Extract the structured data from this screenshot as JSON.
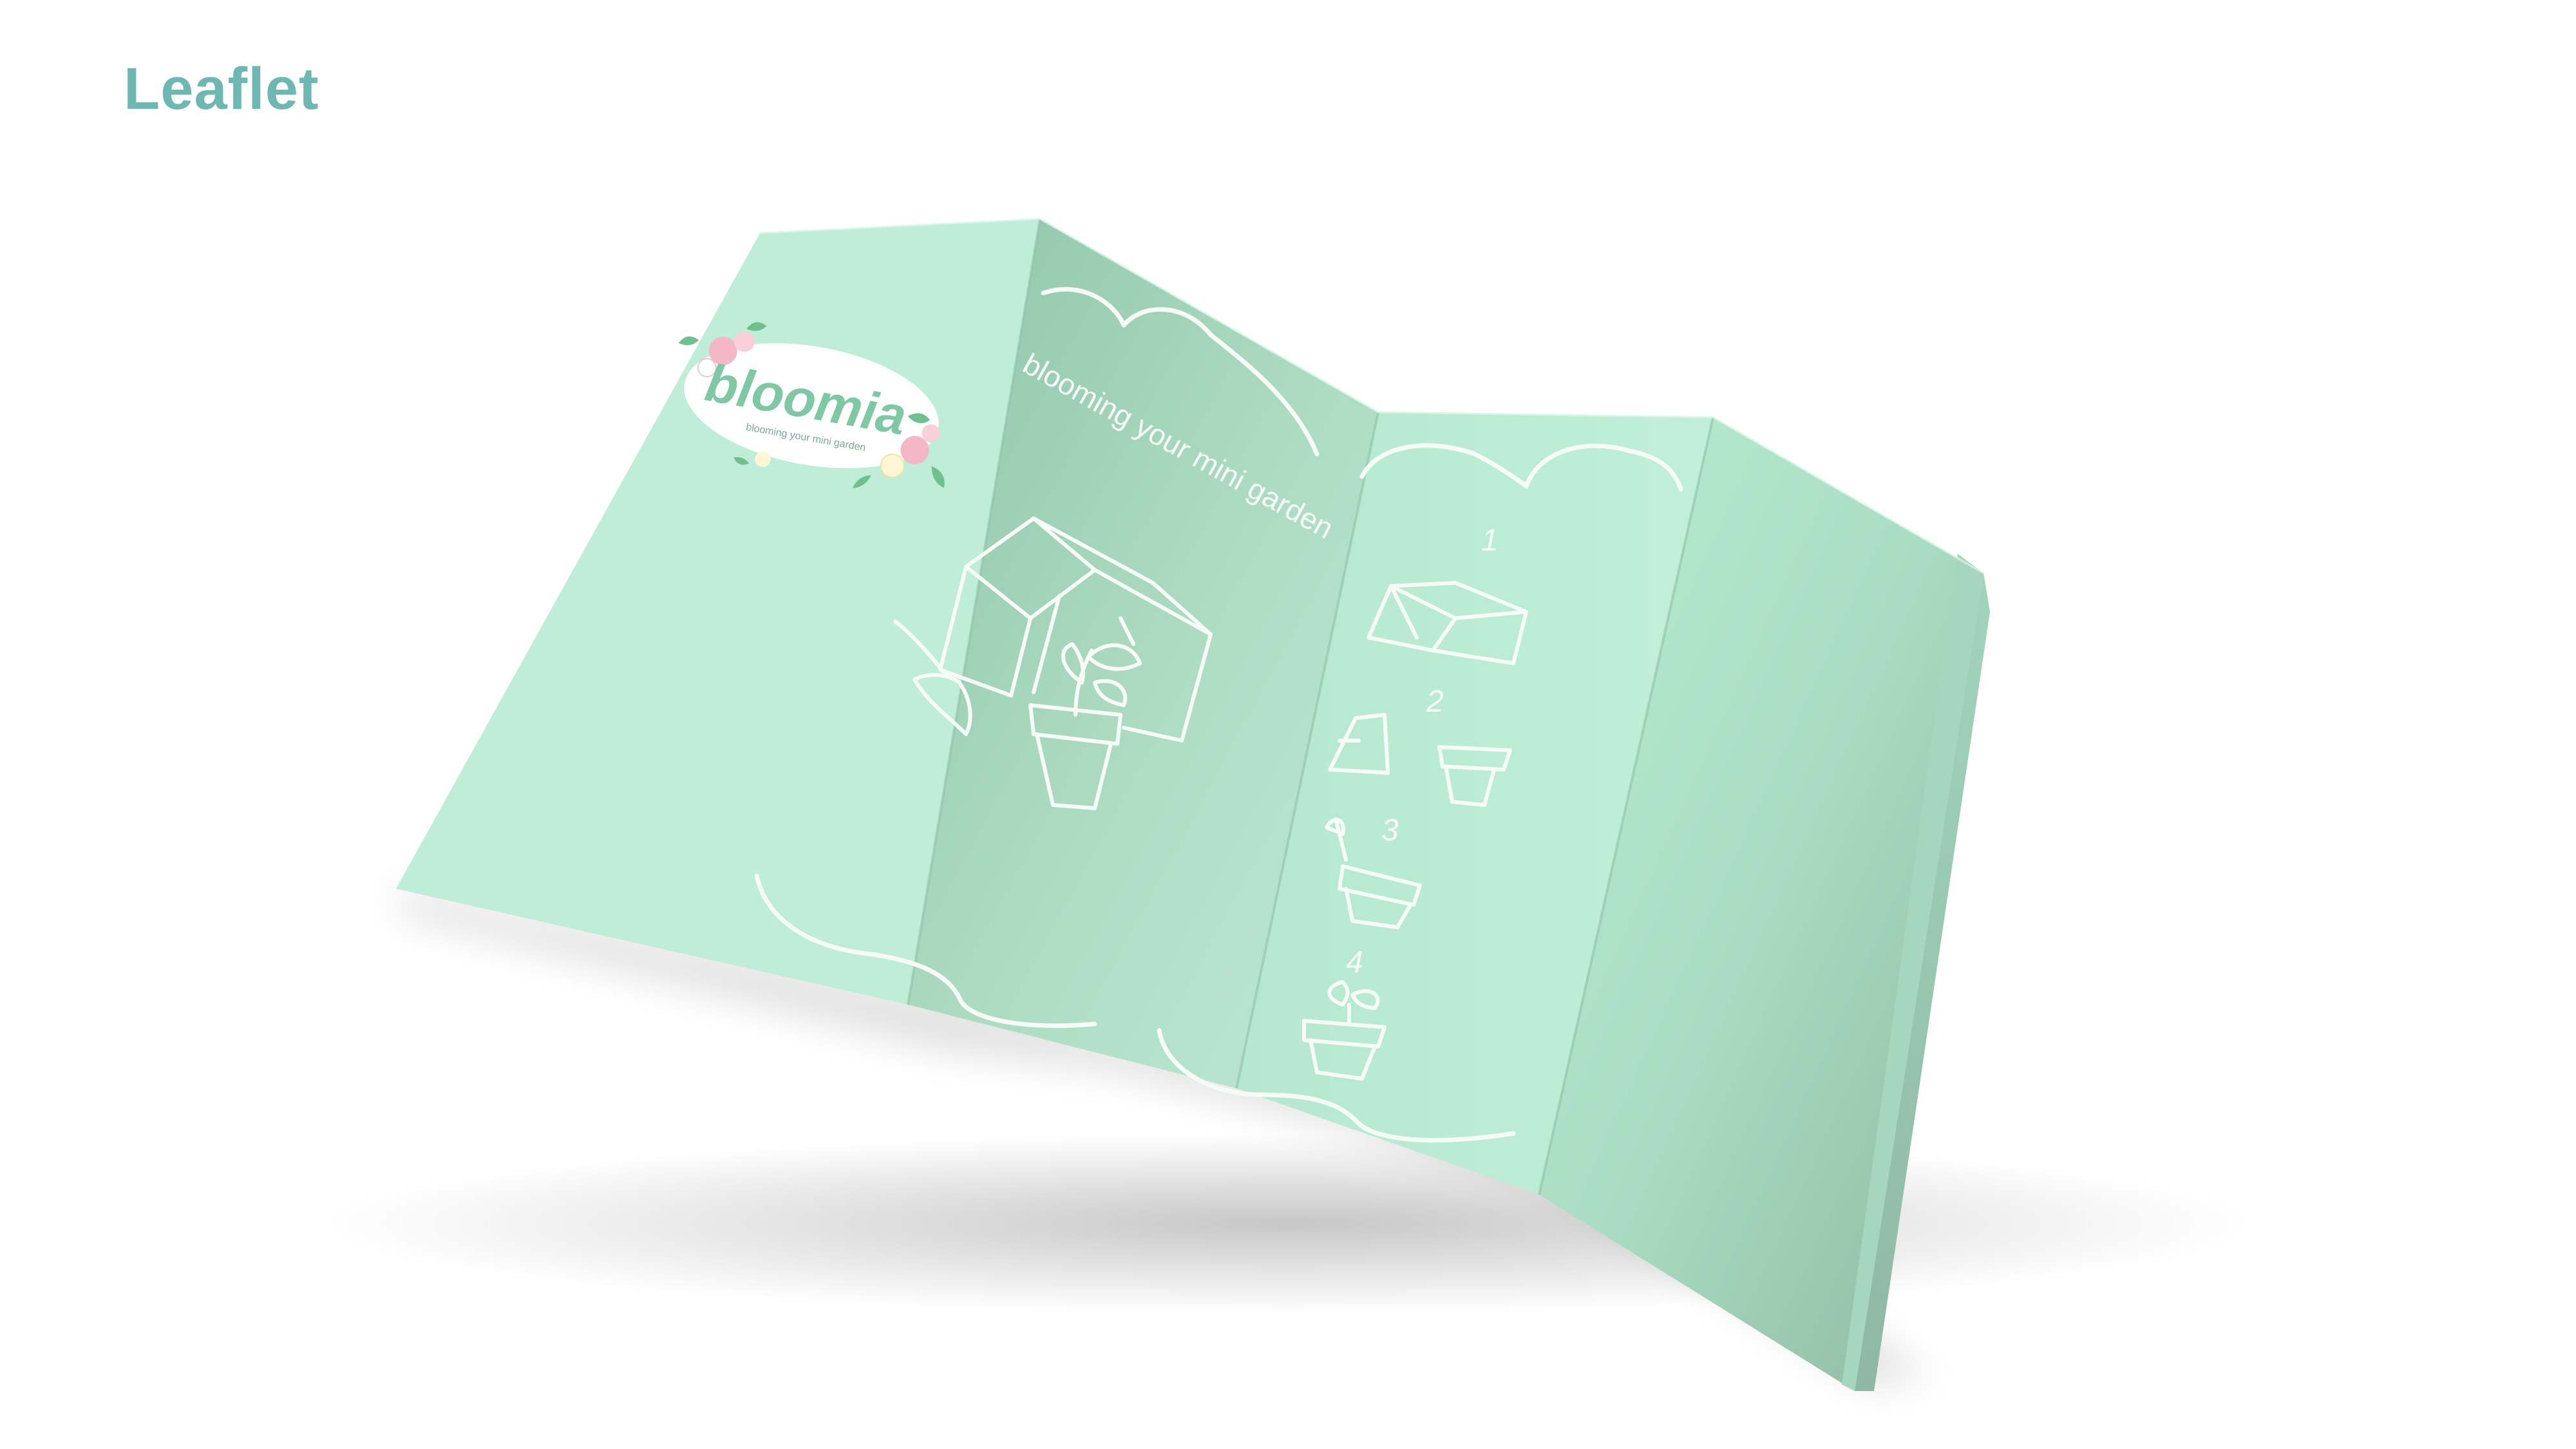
{
  "page": {
    "title": "Leaflet"
  },
  "leaflet": {
    "brand_name": "bloomia",
    "brand_tagline": "blooming your mini garden",
    "headline": "blooming your mini garden",
    "steps": [
      {
        "number": "1",
        "icon": "box-icon"
      },
      {
        "number": "2",
        "icon": "pots-icon"
      },
      {
        "number": "3",
        "icon": "trowel-pot-icon"
      },
      {
        "number": "4",
        "icon": "sprout-pot-icon"
      }
    ],
    "colors": {
      "paper": "#bcecd5",
      "paper_shade": "#9ccdb5",
      "paper_dark": "#8fb9a4",
      "line_art": "#f6fbf8",
      "brand_pink": "#e98fa6",
      "brand_green": "#7fc7a5",
      "title": "#6fb7b3"
    }
  }
}
